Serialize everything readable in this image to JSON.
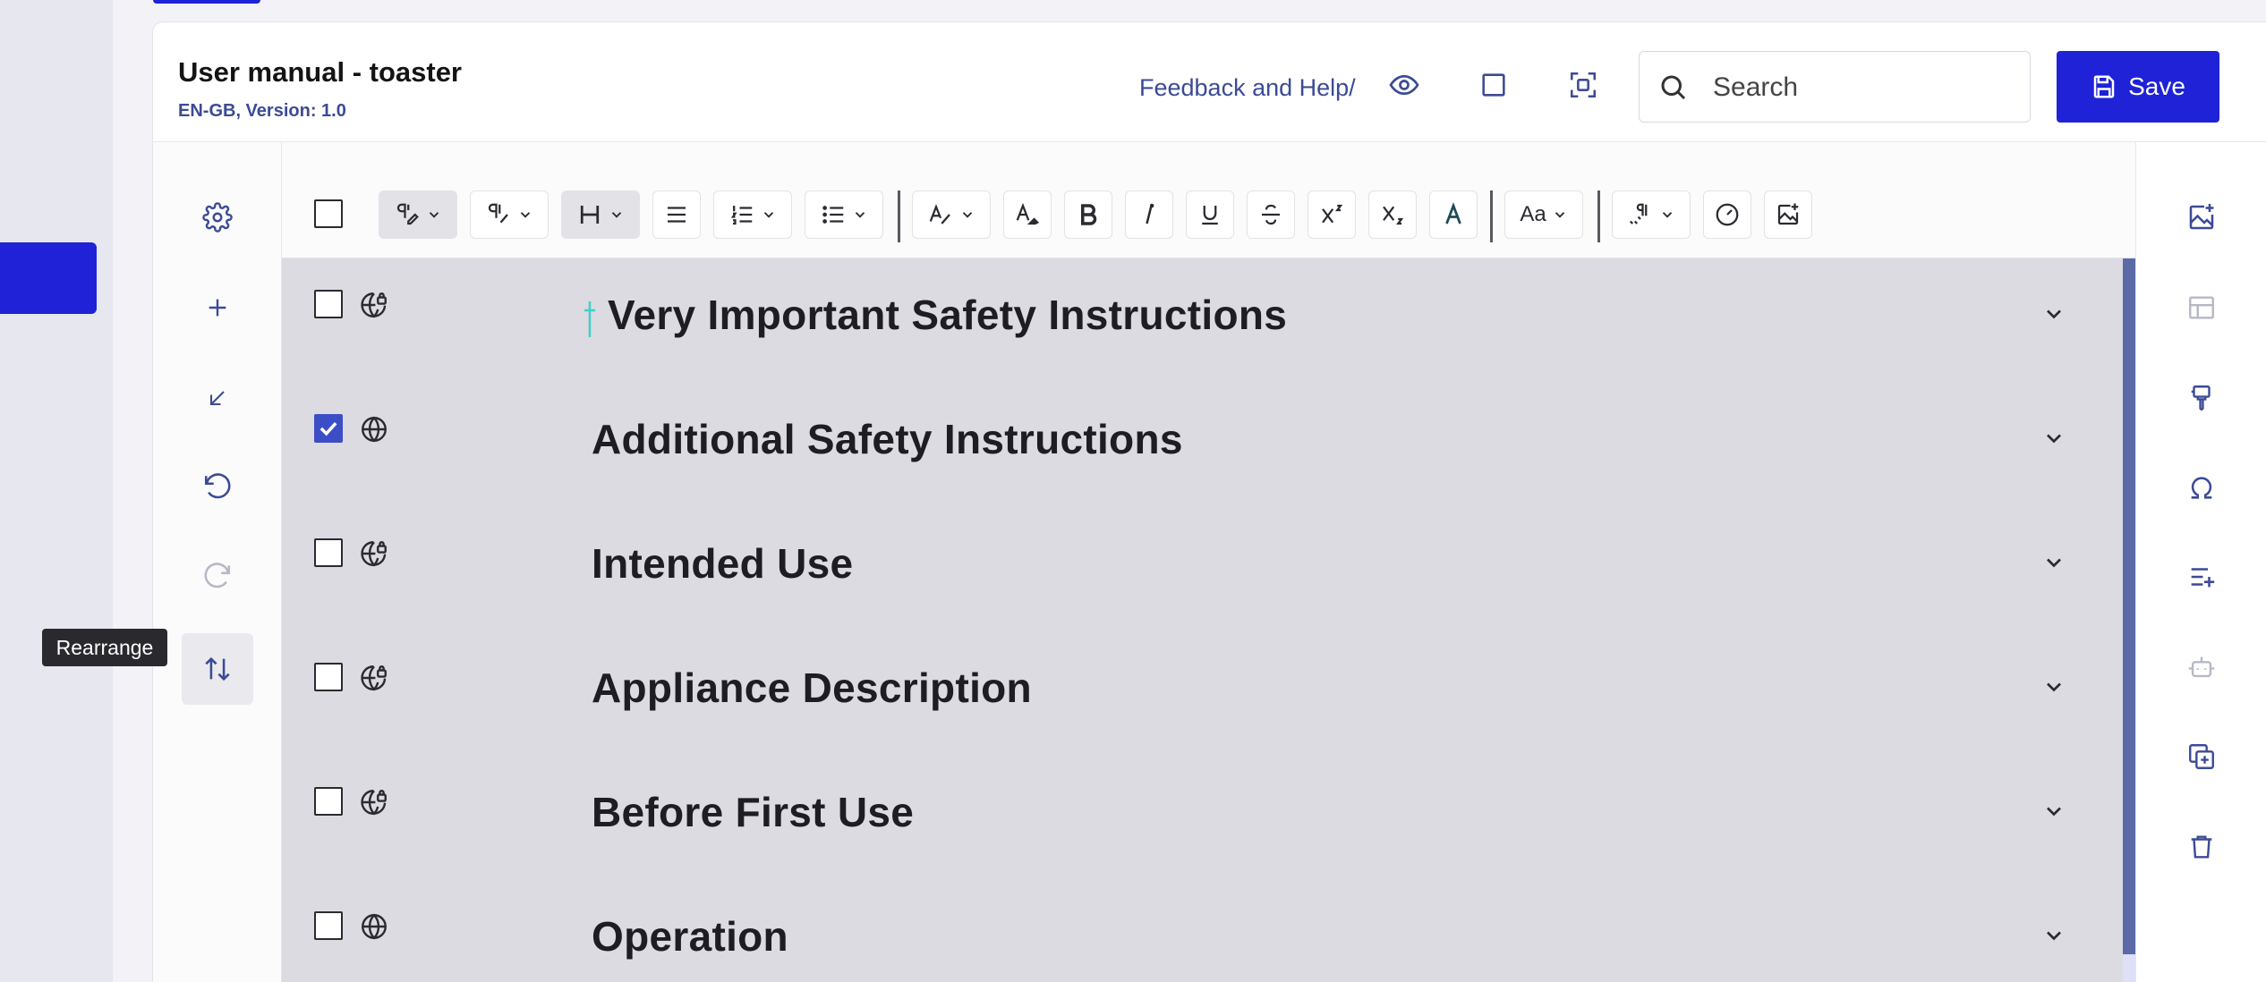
{
  "document": {
    "title": "User manual - toaster",
    "subtitle": "EN-GB, Version: 1.0"
  },
  "header": {
    "feedback_link": "Feedback and Help/",
    "search_placeholder": "Search",
    "save_label": "Save"
  },
  "left_tools": {
    "tooltip": "Rearrange",
    "items": [
      "gear-icon",
      "plus-icon",
      "arrow-down-left-icon",
      "undo-icon",
      "redo-icon",
      "sort-arrows-icon"
    ]
  },
  "toolbar": {
    "font_size_label": "Aa"
  },
  "sections": [
    {
      "title": "Very Important Safety Instructions",
      "checked": false,
      "locked": true
    },
    {
      "title": "Additional Safety Instructions",
      "checked": true,
      "locked": false
    },
    {
      "title": "Intended Use",
      "checked": false,
      "locked": true
    },
    {
      "title": "Appliance Description",
      "checked": false,
      "locked": true
    },
    {
      "title": "Before First Use",
      "checked": false,
      "locked": true
    },
    {
      "title": "Operation",
      "checked": false,
      "locked": false
    }
  ],
  "right_tools": [
    "insert-image-icon",
    "table-icon",
    "brush-icon",
    "omega-icon",
    "list-add-icon",
    "robot-icon",
    "duplicate-icon",
    "trash-icon"
  ],
  "colors": {
    "brand": "#1f22d6",
    "link": "#3c4a96",
    "checkbox": "#3c4ec6",
    "content_bg": "#dcdbe1",
    "scrollbar": "#5b6aa6"
  }
}
